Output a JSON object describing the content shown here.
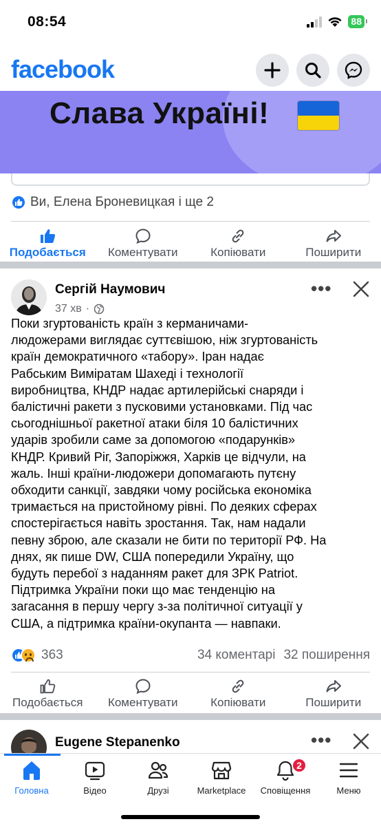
{
  "status": {
    "time": "08:54",
    "battery": "88"
  },
  "header": {
    "logo": "facebook",
    "buttons": [
      "plus-icon",
      "search-icon",
      "messenger-icon"
    ]
  },
  "banner": {
    "text": "Слава Україні!"
  },
  "prev_post": {
    "reactions_text": "Ви, Елена Броневицкая і ще 2",
    "actions": {
      "like": "Подобається",
      "comment": "Коментувати",
      "copy": "Копіювати",
      "share": "Поширити"
    }
  },
  "post": {
    "author": "Сергій Наумович",
    "time": "37 хв",
    "dot": "·",
    "body_lines": [
      "Поки згуртованість країн з керманичами-",
      "людожерами виглядає суттєвішою, ніж згуртованість",
      "країн демократичного «табору». Іран надає",
      "Рабським Виміратам Шахеді і технології",
      "виробництва, КНДР надає артилерійські снаряди і",
      "балістичні ракети з пусковими установками. Під час",
      "сьогоднішньої ракетної атаки біля 10 балістичних",
      "ударів зробили саме за допомогою «подарунків»",
      "КНДР. Кривий Ріг, Запоріжжя, Харків це відчули, на",
      "жаль. Інші країни-людожери допомагають путєну",
      "обходити санкції, завдяки чому російська економіка",
      "тримається на пристойному рівні. По деяких сферах",
      "спостерігається навіть зростання. Так, нам надали",
      "певну зброю, але сказали не бити по території РФ. На",
      "днях, як пише DW, США попередили Україну, що",
      "будуть перебої з наданням ракет для ЗРК Patriot.",
      "Підтримка України поки що має тенденцію на",
      "загасання в першу чергу з-за політичної ситуації у",
      "США, а підтримка країни-окупанта — навпаки."
    ],
    "reactions_count": "363",
    "comments": "34 коментарі",
    "shares": "32 поширення",
    "actions": {
      "like": "Подобається",
      "comment": "Коментувати",
      "copy": "Копіювати",
      "share": "Поширити"
    }
  },
  "next_post": {
    "author": "Eugene Stepanenko"
  },
  "bottom_nav": {
    "items": [
      {
        "label": "Головна",
        "icon": "home-icon"
      },
      {
        "label": "Відео",
        "icon": "video-icon"
      },
      {
        "label": "Друзі",
        "icon": "friends-icon"
      },
      {
        "label": "Marketplace",
        "icon": "marketplace-icon"
      },
      {
        "label": "Сповіщення",
        "icon": "bell-icon"
      },
      {
        "label": "Меню",
        "icon": "menu-icon"
      }
    ],
    "notifications_badge": "2"
  },
  "colors": {
    "brand": "#1877f2",
    "badge": "#e41e3f",
    "battery": "#34c759",
    "banner": "#8b83f2"
  }
}
